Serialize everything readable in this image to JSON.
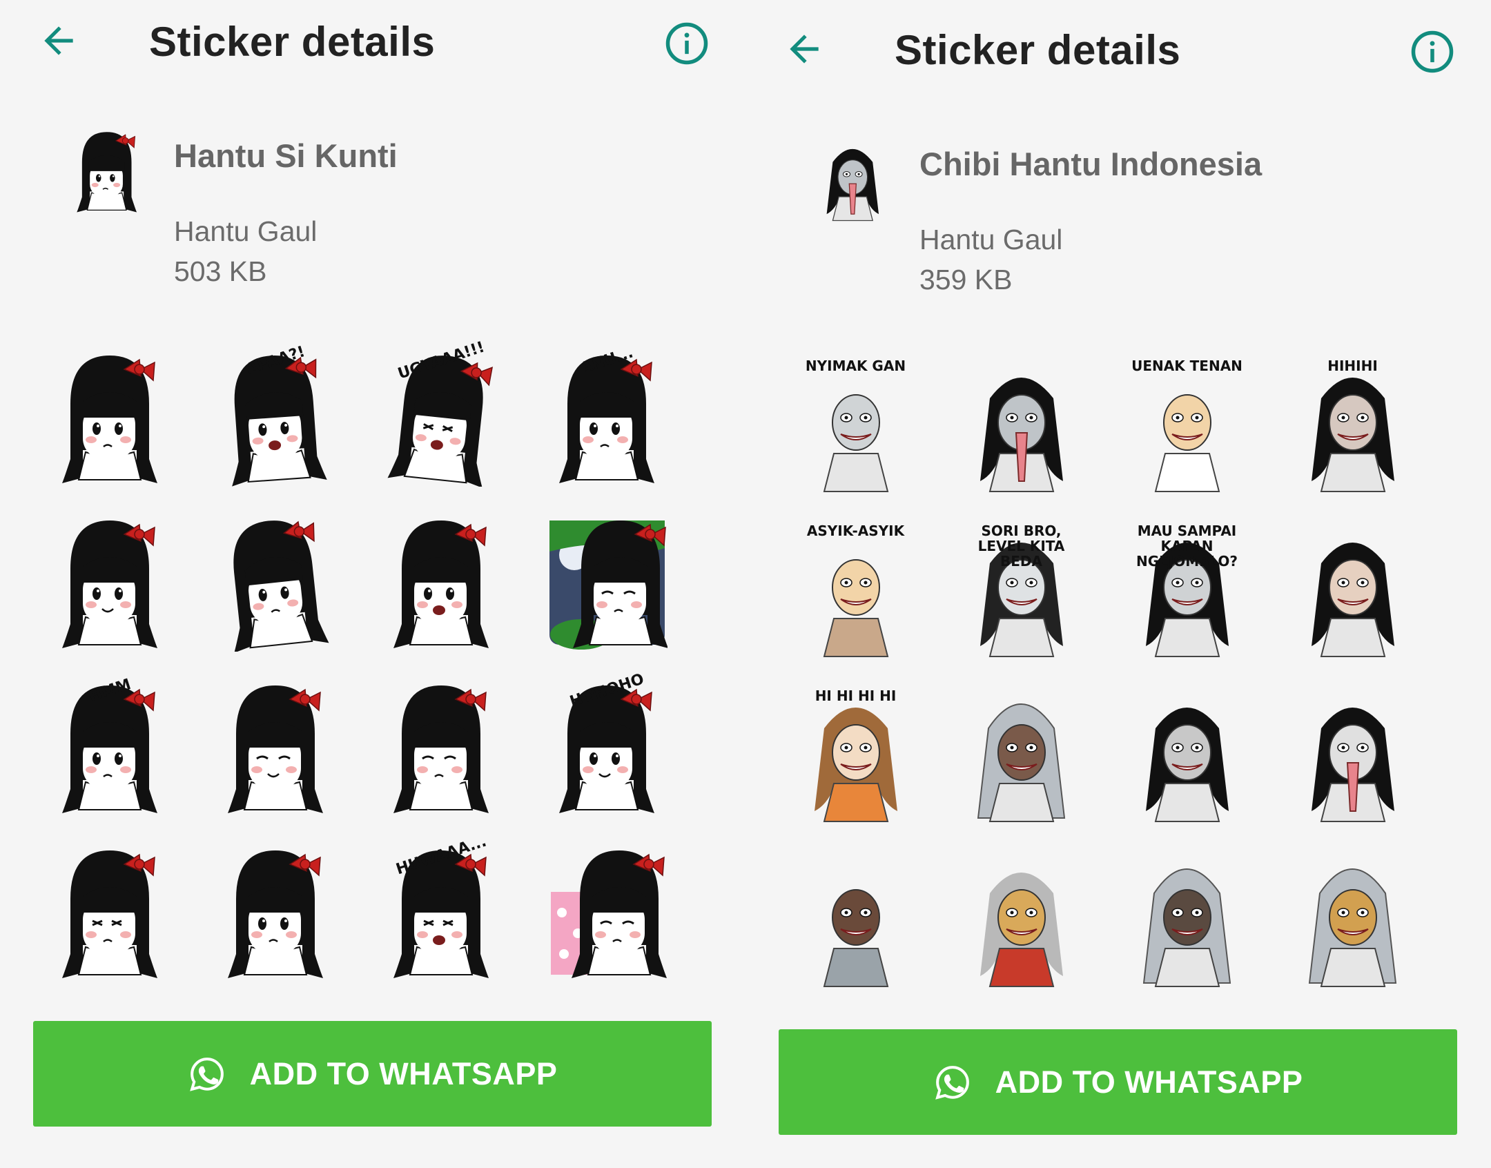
{
  "colors": {
    "accent": "#128c7e",
    "button": "#4dbf3d",
    "hair": "#111111",
    "bow": "#c8201e"
  },
  "panels": [
    {
      "header": {
        "title": "Sticker details",
        "back_icon": "arrow-left-icon",
        "info_icon": "info-icon"
      },
      "pack": {
        "name": "Hantu Si Kunti",
        "author": "Hantu Gaul",
        "size": "503 KB"
      },
      "stickers": [
        {
          "caption": ""
        },
        {
          "caption": "APAA?!"
        },
        {
          "caption": "UGYAAA!!!"
        },
        {
          "caption": "ANU..."
        },
        {
          "caption": ""
        },
        {
          "caption": ""
        },
        {
          "caption": ""
        },
        {
          "caption": ""
        },
        {
          "caption": "HMM"
        },
        {
          "caption": ""
        },
        {
          "caption": ""
        },
        {
          "caption": "HOHOHO"
        },
        {
          "caption": ""
        },
        {
          "caption": ""
        },
        {
          "caption": "HUWAAA..."
        },
        {
          "caption": ""
        }
      ],
      "button": {
        "label": "ADD TO WHATSAPP",
        "icon": "whatsapp-icon"
      }
    },
    {
      "header": {
        "title": "Sticker details",
        "back_icon": "arrow-left-icon",
        "info_icon": "info-icon"
      },
      "pack": {
        "name": "Chibi Hantu Indonesia",
        "author": "Hantu Gaul",
        "size": "359 KB"
      },
      "stickers": [
        {
          "caption": "NYIMAK GAN"
        },
        {
          "caption": ""
        },
        {
          "caption": "UENAK TENAN"
        },
        {
          "caption": "HIHIHI"
        },
        {
          "caption": "ASYIK-ASYIK"
        },
        {
          "caption": "SORI BRO, LEVEL KITA BEDA"
        },
        {
          "caption": "MAU SAMPAI KAPAN NGEJOMBLO?"
        },
        {
          "caption": ""
        },
        {
          "caption": "HI HI HI HI"
        },
        {
          "caption": ""
        },
        {
          "caption": ""
        },
        {
          "caption": ""
        },
        {
          "caption": ""
        },
        {
          "caption": ""
        },
        {
          "caption": ""
        },
        {
          "caption": ""
        }
      ],
      "button": {
        "label": "ADD TO WHATSAPP",
        "icon": "whatsapp-icon"
      }
    }
  ]
}
